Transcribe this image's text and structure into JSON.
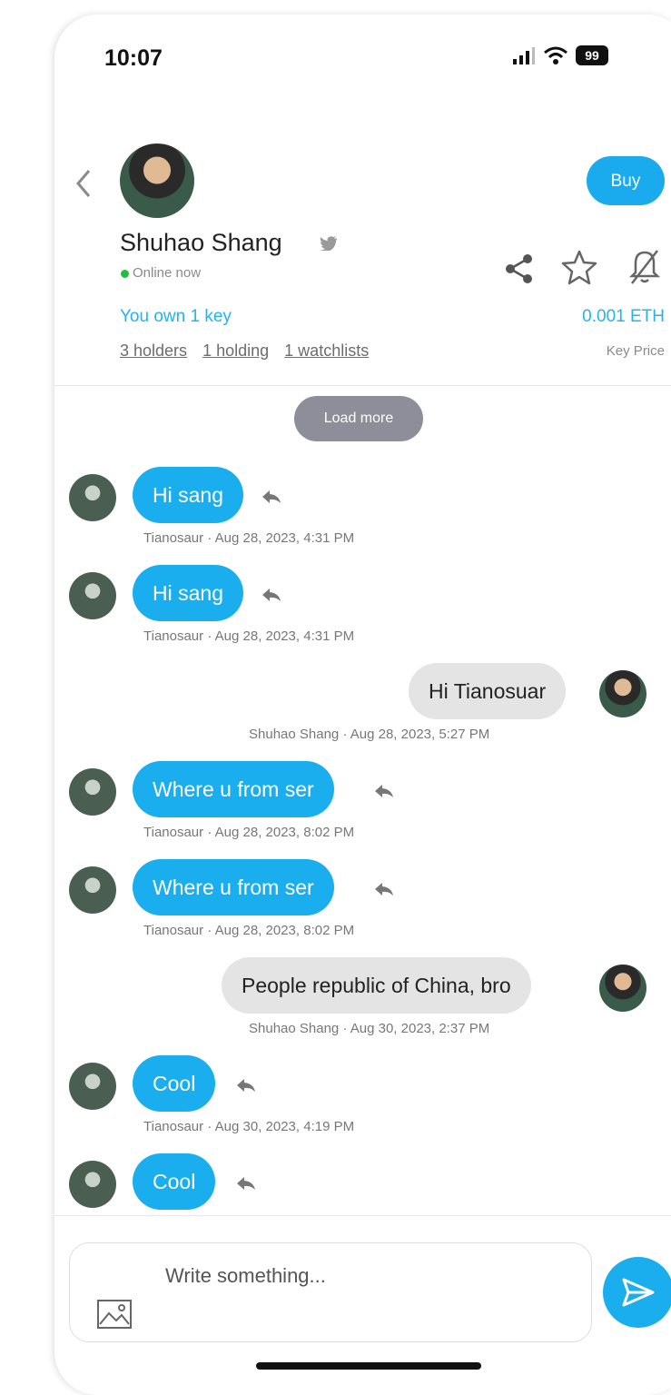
{
  "status_bar": {
    "time": "10:07",
    "battery": "99"
  },
  "profile": {
    "name": "Shuhao Shang",
    "status": "Online now",
    "own_keys": "You own 1 key",
    "holders": "3 holders",
    "holding": "1 holding",
    "watchlists": "1 watchlists",
    "buy_label": "Buy",
    "key_price": "0.001 ETH",
    "key_price_label": "Key Price"
  },
  "chat": {
    "load_more_label": "Load more",
    "messages": [
      {
        "side": "other",
        "text": "Hi sang",
        "meta": "Tianosaur · Aug 28, 2023, 4:31 PM"
      },
      {
        "side": "other",
        "text": "Hi sang",
        "meta": "Tianosaur · Aug 28, 2023, 4:31 PM"
      },
      {
        "side": "me",
        "text": "Hi Tianosuar",
        "meta": "Shuhao Shang · Aug 28, 2023, 5:27 PM"
      },
      {
        "side": "other",
        "text": "Where u from ser",
        "meta": "Tianosaur · Aug 28, 2023, 8:02 PM"
      },
      {
        "side": "other",
        "text": "Where u from ser",
        "meta": "Tianosaur · Aug 28, 2023, 8:02 PM"
      },
      {
        "side": "me",
        "text": "People republic of China, bro",
        "meta": "Shuhao Shang · Aug 30, 2023, 2:37 PM"
      },
      {
        "side": "other",
        "text": "Cool",
        "meta": "Tianosaur · Aug 30, 2023, 4:19 PM"
      },
      {
        "side": "other",
        "text": "Cool",
        "meta": ""
      }
    ]
  },
  "composer": {
    "placeholder": "Write something..."
  },
  "colors": {
    "accent": "#1aaeee",
    "my_bubble": "#e4e4e4",
    "online": "#1dbf3c"
  },
  "icons": {
    "back": "chevron-left-icon",
    "twitter": "twitter-icon",
    "share": "share-icon",
    "star": "star-icon",
    "bell": "bell-off-icon",
    "reply": "reply-icon",
    "image": "image-icon",
    "send": "send-icon"
  }
}
